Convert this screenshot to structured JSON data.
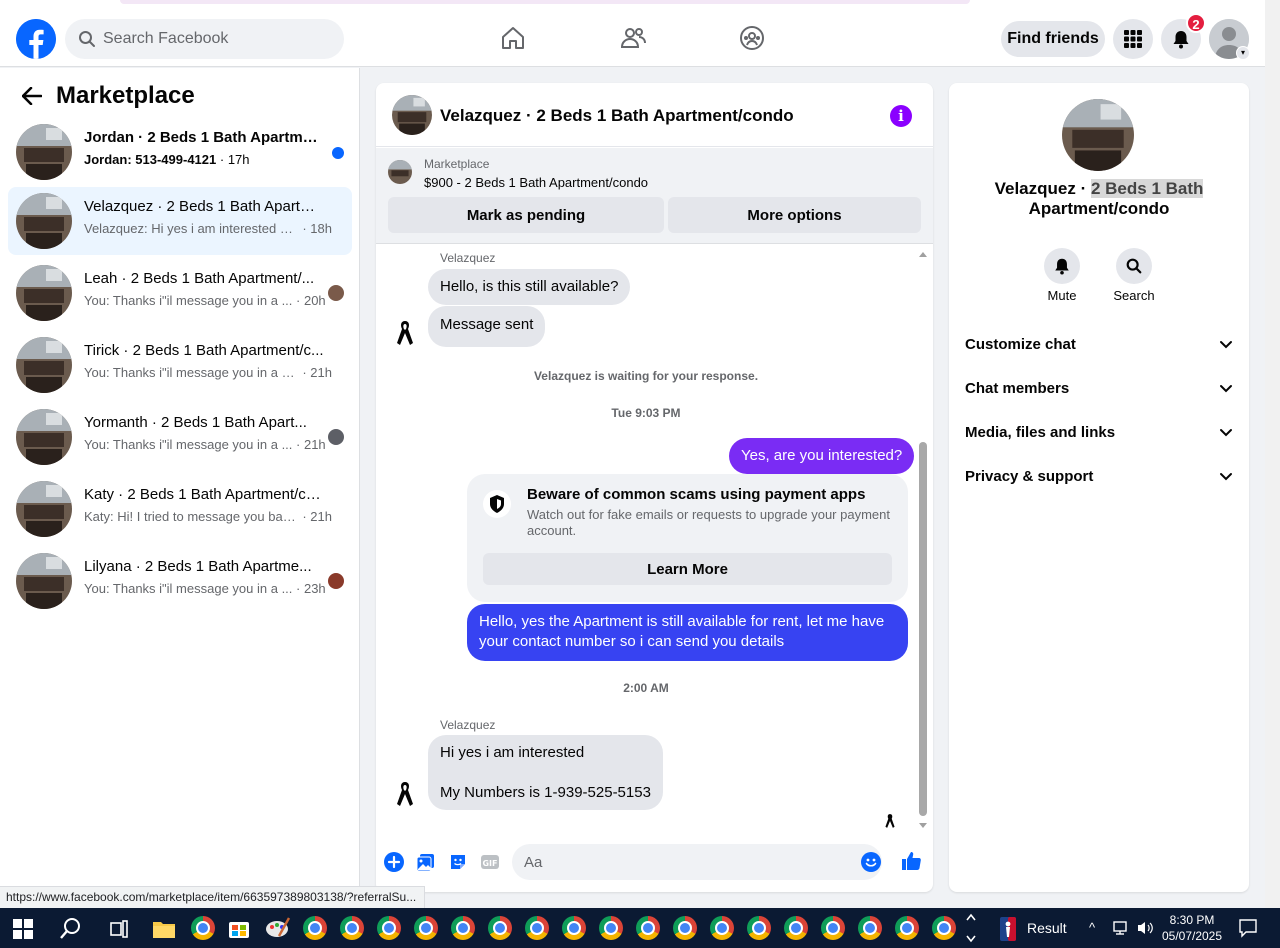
{
  "header": {
    "search_placeholder": "Search Facebook",
    "find_friends_label": "Find friends",
    "notifications_count": "2"
  },
  "sidebar": {
    "title": "Marketplace",
    "conversations": [
      {
        "title": "Jordan · 2 Beds 1 Bath Apartmen...",
        "snippet": "Jordan: 513-499-4121",
        "time": "· 17h",
        "unread": true
      },
      {
        "title": "Velazquez · 2 Beds 1 Bath Apartme...",
        "snippet": "Velazquez: Hi yes i am interested My...",
        "time": "· 18h",
        "active": true
      },
      {
        "title": "Leah · 2 Beds 1 Bath Apartment/...",
        "snippet": "You: Thanks i\"il message you in a ...",
        "time": "· 20h"
      },
      {
        "title": "Tirick · 2 Beds 1 Bath Apartment/c...",
        "snippet": "You: Thanks i\"il message you in a m...",
        "time": "· 21h"
      },
      {
        "title": "Yormanth · 2 Beds 1 Bath Apart...",
        "snippet": "You: Thanks i\"il message you in a ...",
        "time": "· 21h"
      },
      {
        "title": "Katy · 2 Beds 1 Bath Apartment/co...",
        "snippet": "Katy: Hi! I tried to message you back...",
        "time": "· 21h"
      },
      {
        "title": "Lilyana · 2 Beds 1 Bath Apartme...",
        "snippet": "You: Thanks i\"il message you in a ...",
        "time": "· 23h"
      }
    ]
  },
  "chat": {
    "title": "Velazquez · 2 Beds 1 Bath Apartment/condo",
    "listing_label": "Marketplace",
    "listing_item": "$900 - 2 Beds 1 Bath Apartment/condo",
    "mark_pending_label": "Mark as pending",
    "more_options_label": "More options",
    "sender_name": "Velazquez",
    "msg_1": "Hello, is this still available?",
    "msg_2": "Message sent",
    "waiting_text": "Velazquez is waiting for your response.",
    "timestamp_1": "Tue 9:03 PM",
    "msg_3": "Yes, are you interested?",
    "scam_title": "Beware of common scams using payment apps",
    "scam_body": "Watch out for fake emails or requests to upgrade your payment account.",
    "learn_more_label": "Learn More",
    "msg_4": "Hello, yes the Apartment is still available for rent, let me have your contact number so i can send you details",
    "timestamp_2": "2:00 AM",
    "msg_5_line1": "Hi yes i am interested",
    "msg_5_line2": "My Numbers is 1-939-525-5153",
    "composer_placeholder": "Aa"
  },
  "info_panel": {
    "name_part1": "Velazquez · ",
    "name_part2": "2 Beds 1 Bath",
    "name_part3": "Apartment/condo",
    "mute_label": "Mute",
    "search_label": "Search",
    "rows": [
      "Customize chat",
      "Chat members",
      "Media, files and links",
      "Privacy & support"
    ]
  },
  "status_url": "https://www.facebook.com/marketplace/item/663597389803138/?referralSu...",
  "taskbar": {
    "result_label": "Result",
    "time": "8:30 PM",
    "date": "05/07/2025"
  },
  "colors": {
    "brand": "#0866ff",
    "outgoing_bubble": "#3743f2",
    "info_accent": "#8a00ff"
  }
}
